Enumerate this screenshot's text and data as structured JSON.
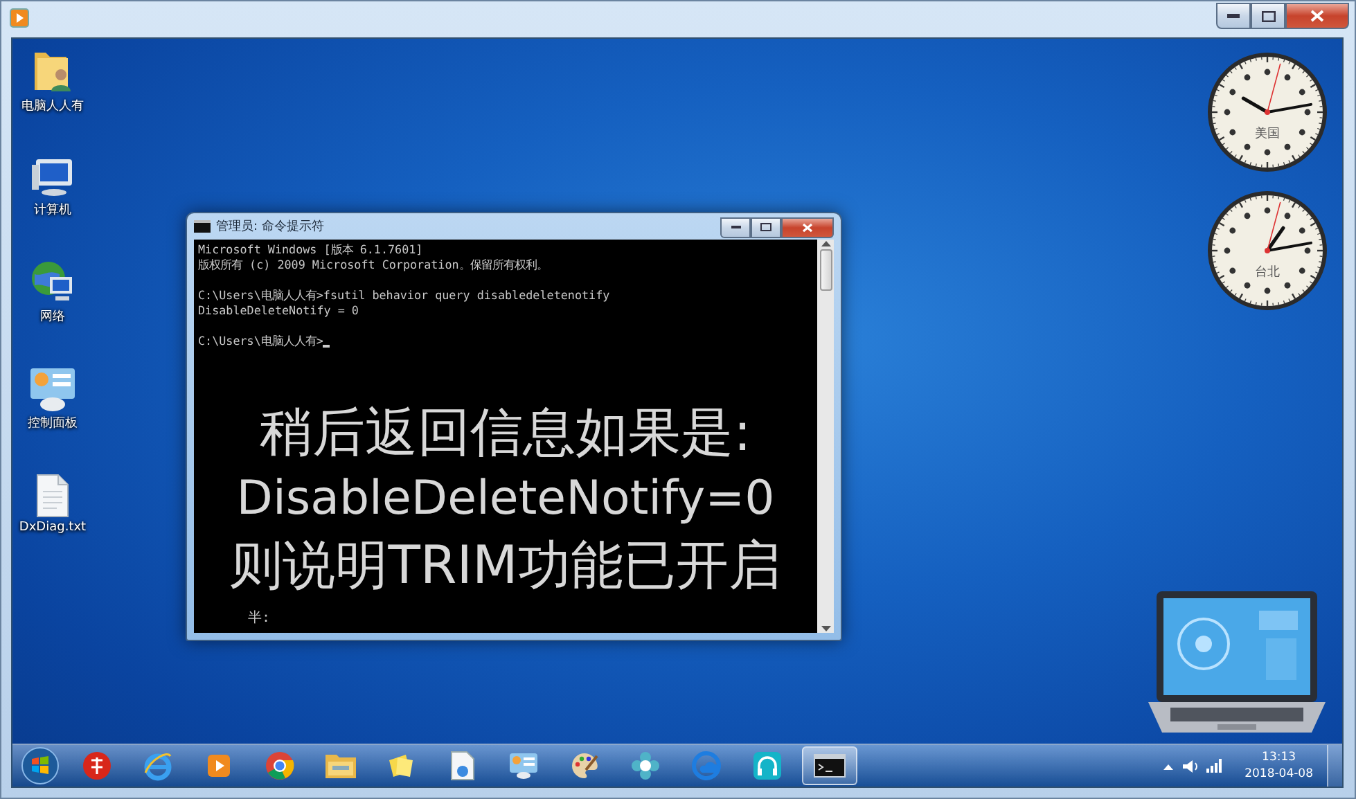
{
  "desktop": {
    "icons": [
      {
        "label": "电脑人人有"
      },
      {
        "label": "计算机"
      },
      {
        "label": "网络"
      },
      {
        "label": "控制面板"
      },
      {
        "label": "DxDiag.txt"
      }
    ]
  },
  "console": {
    "title": "管理员: 命令提示符",
    "blocks": [
      [
        "Microsoft Windows [版本 6.1.7601]",
        "版权所有 (c) 2009 Microsoft Corporation。保留所有权利。"
      ],
      [
        "C:\\Users\\电脑人人有>fsutil behavior query disabledeletenotify",
        "DisableDeleteNotify = 0"
      ],
      [
        "C:\\Users\\电脑人人有>"
      ]
    ],
    "caption": [
      "稍后返回信息如果是:",
      "DisableDeleteNotify=0",
      "则说明TRIM功能已开启"
    ],
    "partial_line": "半:"
  },
  "clocks": [
    {
      "label": "美国"
    },
    {
      "label": "台北"
    }
  ],
  "taskbar": {
    "buttons": [
      {
        "selected": false
      },
      {
        "selected": false
      },
      {
        "selected": false
      },
      {
        "selected": false
      },
      {
        "selected": false
      },
      {
        "selected": false
      },
      {
        "selected": false
      },
      {
        "selected": false
      },
      {
        "selected": false
      },
      {
        "selected": false
      },
      {
        "selected": false
      },
      {
        "selected": false
      },
      {
        "selected": true
      }
    ],
    "time": "13:13",
    "date": "2018-04-08"
  }
}
